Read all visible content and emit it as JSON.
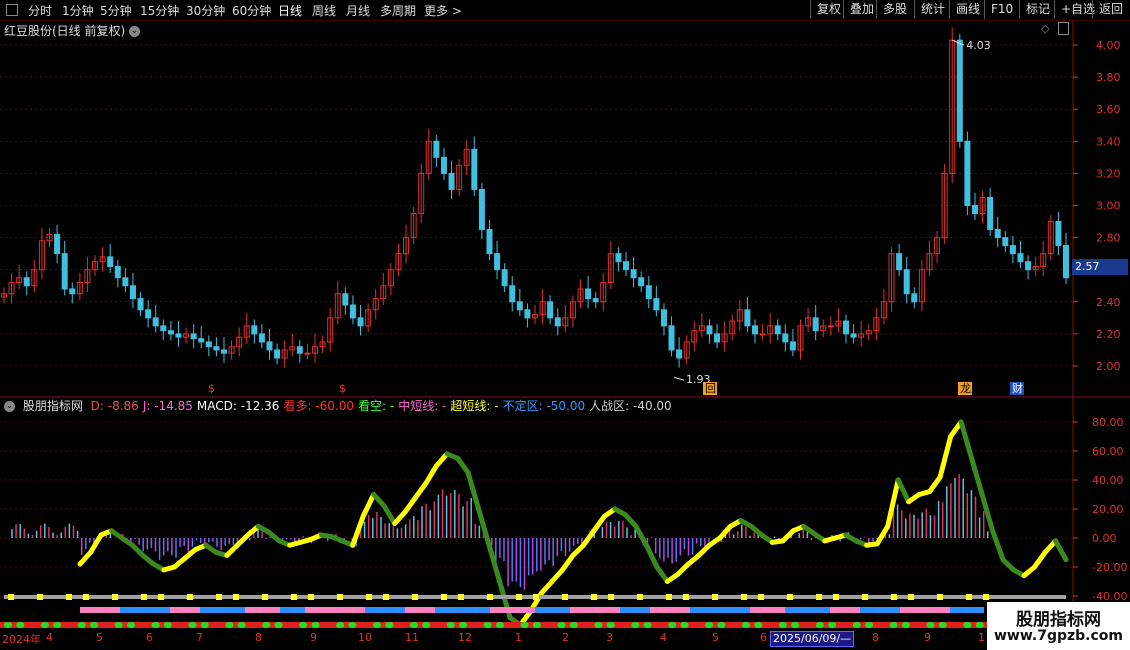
{
  "toolbar": {
    "periods": [
      "分时",
      "1分钟",
      "5分钟",
      "15分钟",
      "30分钟",
      "60分钟",
      "日线",
      "周线",
      "月线",
      "多周期",
      "更多 >"
    ],
    "active_period": "日线",
    "right_buttons": [
      "复权",
      "叠加",
      "多股",
      "统计",
      "画线",
      "F10",
      "标记",
      "+自选",
      "返回"
    ]
  },
  "stock": {
    "title": "红豆股份(日线 前复权)",
    "current_price": "2.57",
    "high_label": "4.03",
    "low_label": "1.93"
  },
  "price_axis": [
    "4.00",
    "3.80",
    "3.60",
    "3.40",
    "3.20",
    "3.00",
    "2.80",
    "2.60",
    "2.40",
    "2.20",
    "2.00"
  ],
  "indicator_axis": [
    "80.00",
    "60.00",
    "40.00",
    "20.00",
    "0.00",
    "-20.00",
    "-40.00"
  ],
  "indicator": {
    "name": "股朋指标网",
    "items": [
      {
        "label": "D: -8.86",
        "color": "#e05050"
      },
      {
        "label": "J: -14.85",
        "color": "#ff66cc"
      },
      {
        "label": "MACD: -12.36",
        "color": "#ffffff"
      },
      {
        "label": "看多: -60.00",
        "color": "#ff3030"
      },
      {
        "label": "看空: -",
        "color": "#33ff33"
      },
      {
        "label": "中短线: -",
        "color": "#ff66cc"
      },
      {
        "label": "超短线: -",
        "color": "#ffff33"
      },
      {
        "label": "不定区: -50.00",
        "color": "#3399ff"
      },
      {
        "label": "人战区: -40.00",
        "color": "#cccccc"
      }
    ]
  },
  "markers": {
    "s1": "$",
    "s2": "$",
    "back": "回",
    "rank": "龙虎",
    "finance": "财"
  },
  "time_axis": {
    "year": "2024年",
    "months": [
      "4",
      "5",
      "6",
      "7",
      "8",
      "9",
      "10",
      "11",
      "12",
      "1",
      "2",
      "3",
      "4",
      "5",
      "6",
      "7",
      "8",
      "9",
      "1"
    ],
    "date_tip": "2025/06/09/—"
  },
  "watermark": {
    "title": "股朋指标网",
    "url": "www.7gpzb.com"
  },
  "colors": {
    "up": "#e03030",
    "down": "#40c0e0",
    "grid": "#8a1010",
    "yellow": "#ffff00",
    "green": "#3a8a20"
  },
  "chart_data": {
    "type": "candlestick",
    "price_range": [
      1.93,
      4.03
    ],
    "close": [
      2.45,
      2.52,
      2.55,
      2.5,
      2.6,
      2.78,
      2.82,
      2.7,
      2.48,
      2.45,
      2.52,
      2.6,
      2.65,
      2.68,
      2.62,
      2.55,
      2.5,
      2.42,
      2.35,
      2.3,
      2.25,
      2.22,
      2.2,
      2.18,
      2.2,
      2.17,
      2.15,
      2.12,
      2.1,
      2.08,
      2.12,
      2.18,
      2.25,
      2.2,
      2.15,
      2.1,
      2.05,
      2.1,
      2.12,
      2.08,
      2.08,
      2.12,
      2.15,
      2.3,
      2.45,
      2.38,
      2.3,
      2.25,
      2.35,
      2.42,
      2.5,
      2.6,
      2.7,
      2.8,
      2.95,
      3.2,
      3.4,
      3.3,
      3.2,
      3.1,
      3.25,
      3.35,
      3.1,
      2.85,
      2.7,
      2.6,
      2.5,
      2.4,
      2.35,
      2.3,
      2.32,
      2.4,
      2.3,
      2.25,
      2.3,
      2.4,
      2.48,
      2.42,
      2.4,
      2.52,
      2.7,
      2.65,
      2.6,
      2.55,
      2.5,
      2.42,
      2.35,
      2.25,
      2.1,
      2.05,
      2.15,
      2.22,
      2.25,
      2.2,
      2.15,
      2.2,
      2.28,
      2.35,
      2.25,
      2.2,
      2.2,
      2.25,
      2.2,
      2.15,
      2.1,
      2.25,
      2.3,
      2.22,
      2.25,
      2.25,
      2.28,
      2.2,
      2.18,
      2.2,
      2.22,
      2.3,
      2.4,
      2.7,
      2.6,
      2.45,
      2.4,
      2.6,
      2.7,
      2.8,
      3.2,
      4.03,
      3.4,
      3.0,
      2.95,
      3.05,
      2.85,
      2.8,
      2.75,
      2.7,
      2.65,
      2.6,
      2.62,
      2.7,
      2.9,
      2.75,
      2.55
    ],
    "indicator_line": [
      -18,
      -10,
      2,
      5,
      0,
      -5,
      -12,
      -18,
      -22,
      -20,
      -14,
      -8,
      -5,
      -10,
      -12,
      -5,
      2,
      8,
      4,
      -2,
      -5,
      -3,
      -1,
      2,
      1,
      -2,
      -5,
      15,
      30,
      22,
      10,
      18,
      28,
      38,
      50,
      58,
      55,
      45,
      20,
      -5,
      -30,
      -55,
      -60,
      -50,
      -38,
      -30,
      -22,
      -12,
      -5,
      5,
      15,
      20,
      16,
      8,
      -5,
      -20,
      -30,
      -25,
      -18,
      -12,
      -5,
      0,
      8,
      12,
      8,
      2,
      -3,
      -2,
      5,
      8,
      3,
      -2,
      0,
      2,
      -2,
      -5,
      -4,
      8,
      40,
      25,
      30,
      32,
      42,
      70,
      80,
      55,
      30,
      5,
      -15,
      -22,
      -26,
      -20,
      -10,
      -2,
      -15
    ]
  }
}
